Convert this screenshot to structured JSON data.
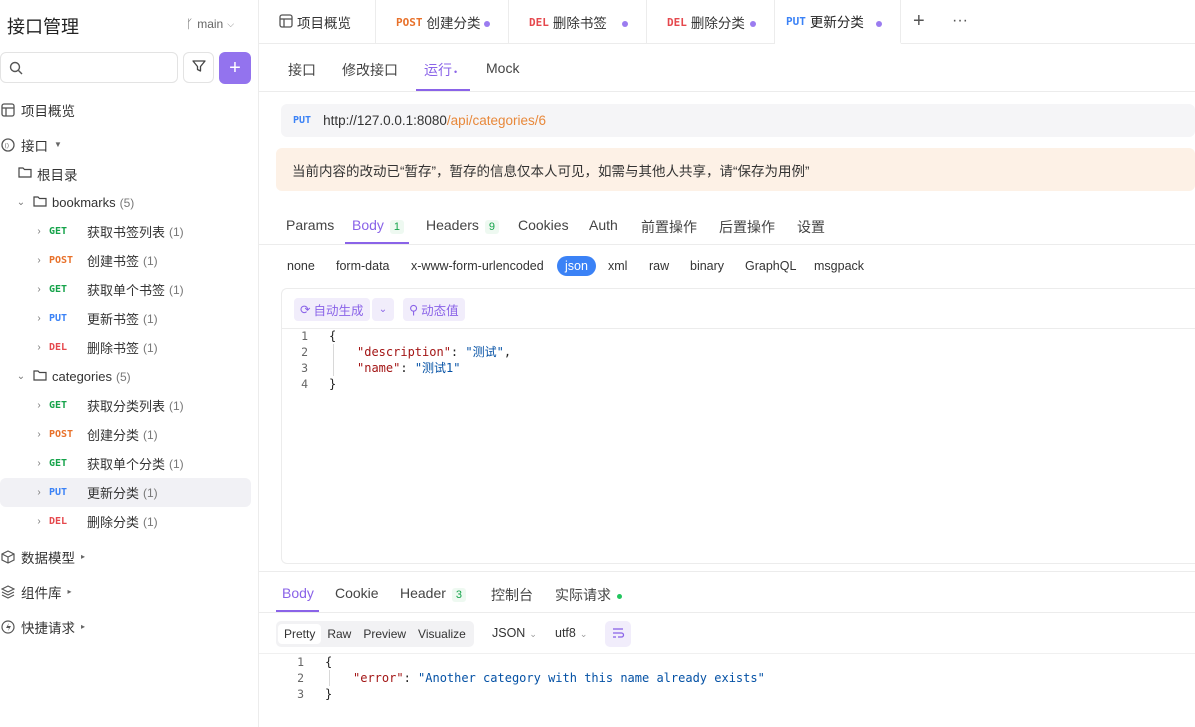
{
  "sidebar": {
    "title": "接口管理",
    "branch": "main",
    "search": {
      "placeholder": ""
    },
    "nav": [
      {
        "label": "项目概览",
        "icon": "overview-icon"
      },
      {
        "label": "接口",
        "icon": "api-icon"
      }
    ],
    "root_label": "根目录",
    "folders": [
      {
        "name": "bookmarks",
        "count": "(5)",
        "items": [
          {
            "method": "GET",
            "label": "获取书签列表",
            "count": "(1)"
          },
          {
            "method": "POST",
            "label": "创建书签",
            "count": "(1)"
          },
          {
            "method": "GET",
            "label": "获取单个书签",
            "count": "(1)"
          },
          {
            "method": "PUT",
            "label": "更新书签",
            "count": "(1)"
          },
          {
            "method": "DEL",
            "label": "删除书签",
            "count": "(1)"
          }
        ]
      },
      {
        "name": "categories",
        "count": "(5)",
        "items": [
          {
            "method": "GET",
            "label": "获取分类列表",
            "count": "(1)"
          },
          {
            "method": "POST",
            "label": "创建分类",
            "count": "(1)"
          },
          {
            "method": "GET",
            "label": "获取单个分类",
            "count": "(1)"
          },
          {
            "method": "PUT",
            "label": "更新分类",
            "count": "(1)"
          },
          {
            "method": "DEL",
            "label": "删除分类",
            "count": "(1)"
          }
        ]
      }
    ],
    "bottom_nav": [
      {
        "label": "数据模型",
        "icon": "data-model-icon"
      },
      {
        "label": "组件库",
        "icon": "components-icon"
      },
      {
        "label": "快捷请求",
        "icon": "quick-request-icon"
      }
    ]
  },
  "top_tabs": [
    {
      "method": "",
      "label": "项目概览"
    },
    {
      "method": "POST",
      "label": "创建分类"
    },
    {
      "method": "DEL",
      "label": "删除书签"
    },
    {
      "method": "DEL",
      "label": "删除分类"
    },
    {
      "method": "PUT",
      "label": "更新分类"
    }
  ],
  "sub_tabs": [
    "接口",
    "修改接口",
    "运行",
    "Mock"
  ],
  "request": {
    "method": "PUT",
    "url_host": "http://127.0.0.1:8080",
    "url_path": "/api/categories/6",
    "notice": "当前内容的改动已“暂存”，暂存的信息仅本人可见，如需与其他人共享，请“保存为用例”",
    "tabs": [
      {
        "label": "Params",
        "badge": ""
      },
      {
        "label": "Body",
        "badge": "1"
      },
      {
        "label": "Headers",
        "badge": "9"
      },
      {
        "label": "Cookies",
        "badge": ""
      },
      {
        "label": "Auth",
        "badge": ""
      },
      {
        "label": "前置操作",
        "badge": ""
      },
      {
        "label": "后置操作",
        "badge": ""
      },
      {
        "label": "设置",
        "badge": ""
      }
    ],
    "body_types": [
      "none",
      "form-data",
      "x-www-form-urlencoded",
      "json",
      "xml",
      "raw",
      "binary",
      "GraphQL",
      "msgpack"
    ],
    "auto_generate": "自动生成",
    "dynamic_value": "动态值",
    "body_lines": [
      {
        "n": "1",
        "text": "{"
      },
      {
        "n": "2",
        "key": "\"description\"",
        "sep": ": ",
        "val": "\"测试\"",
        "tail": ","
      },
      {
        "n": "3",
        "key": "\"name\"",
        "sep": ": ",
        "val": "\"测试1\"",
        "tail": ""
      },
      {
        "n": "4",
        "text": "}"
      }
    ]
  },
  "response": {
    "tabs": [
      {
        "label": "Body",
        "badge": ""
      },
      {
        "label": "Cookie",
        "badge": ""
      },
      {
        "label": "Header",
        "badge": "3"
      },
      {
        "label": "控制台",
        "badge": ""
      },
      {
        "label": "实际请求",
        "badge": ""
      }
    ],
    "view_modes": [
      "Pretty",
      "Raw",
      "Preview",
      "Visualize"
    ],
    "format": "JSON",
    "encoding": "utf8",
    "lines": [
      {
        "n": "1",
        "text": "{"
      },
      {
        "n": "2",
        "key": "\"error\"",
        "sep": ": ",
        "val": "\"Another category with this name already exists\""
      },
      {
        "n": "3",
        "text": "}"
      }
    ]
  },
  "colors": {
    "accent": "#8a63e8",
    "get": "#15a34a",
    "post": "#e8712a",
    "put": "#3b82f6",
    "del": "#e5484d"
  }
}
